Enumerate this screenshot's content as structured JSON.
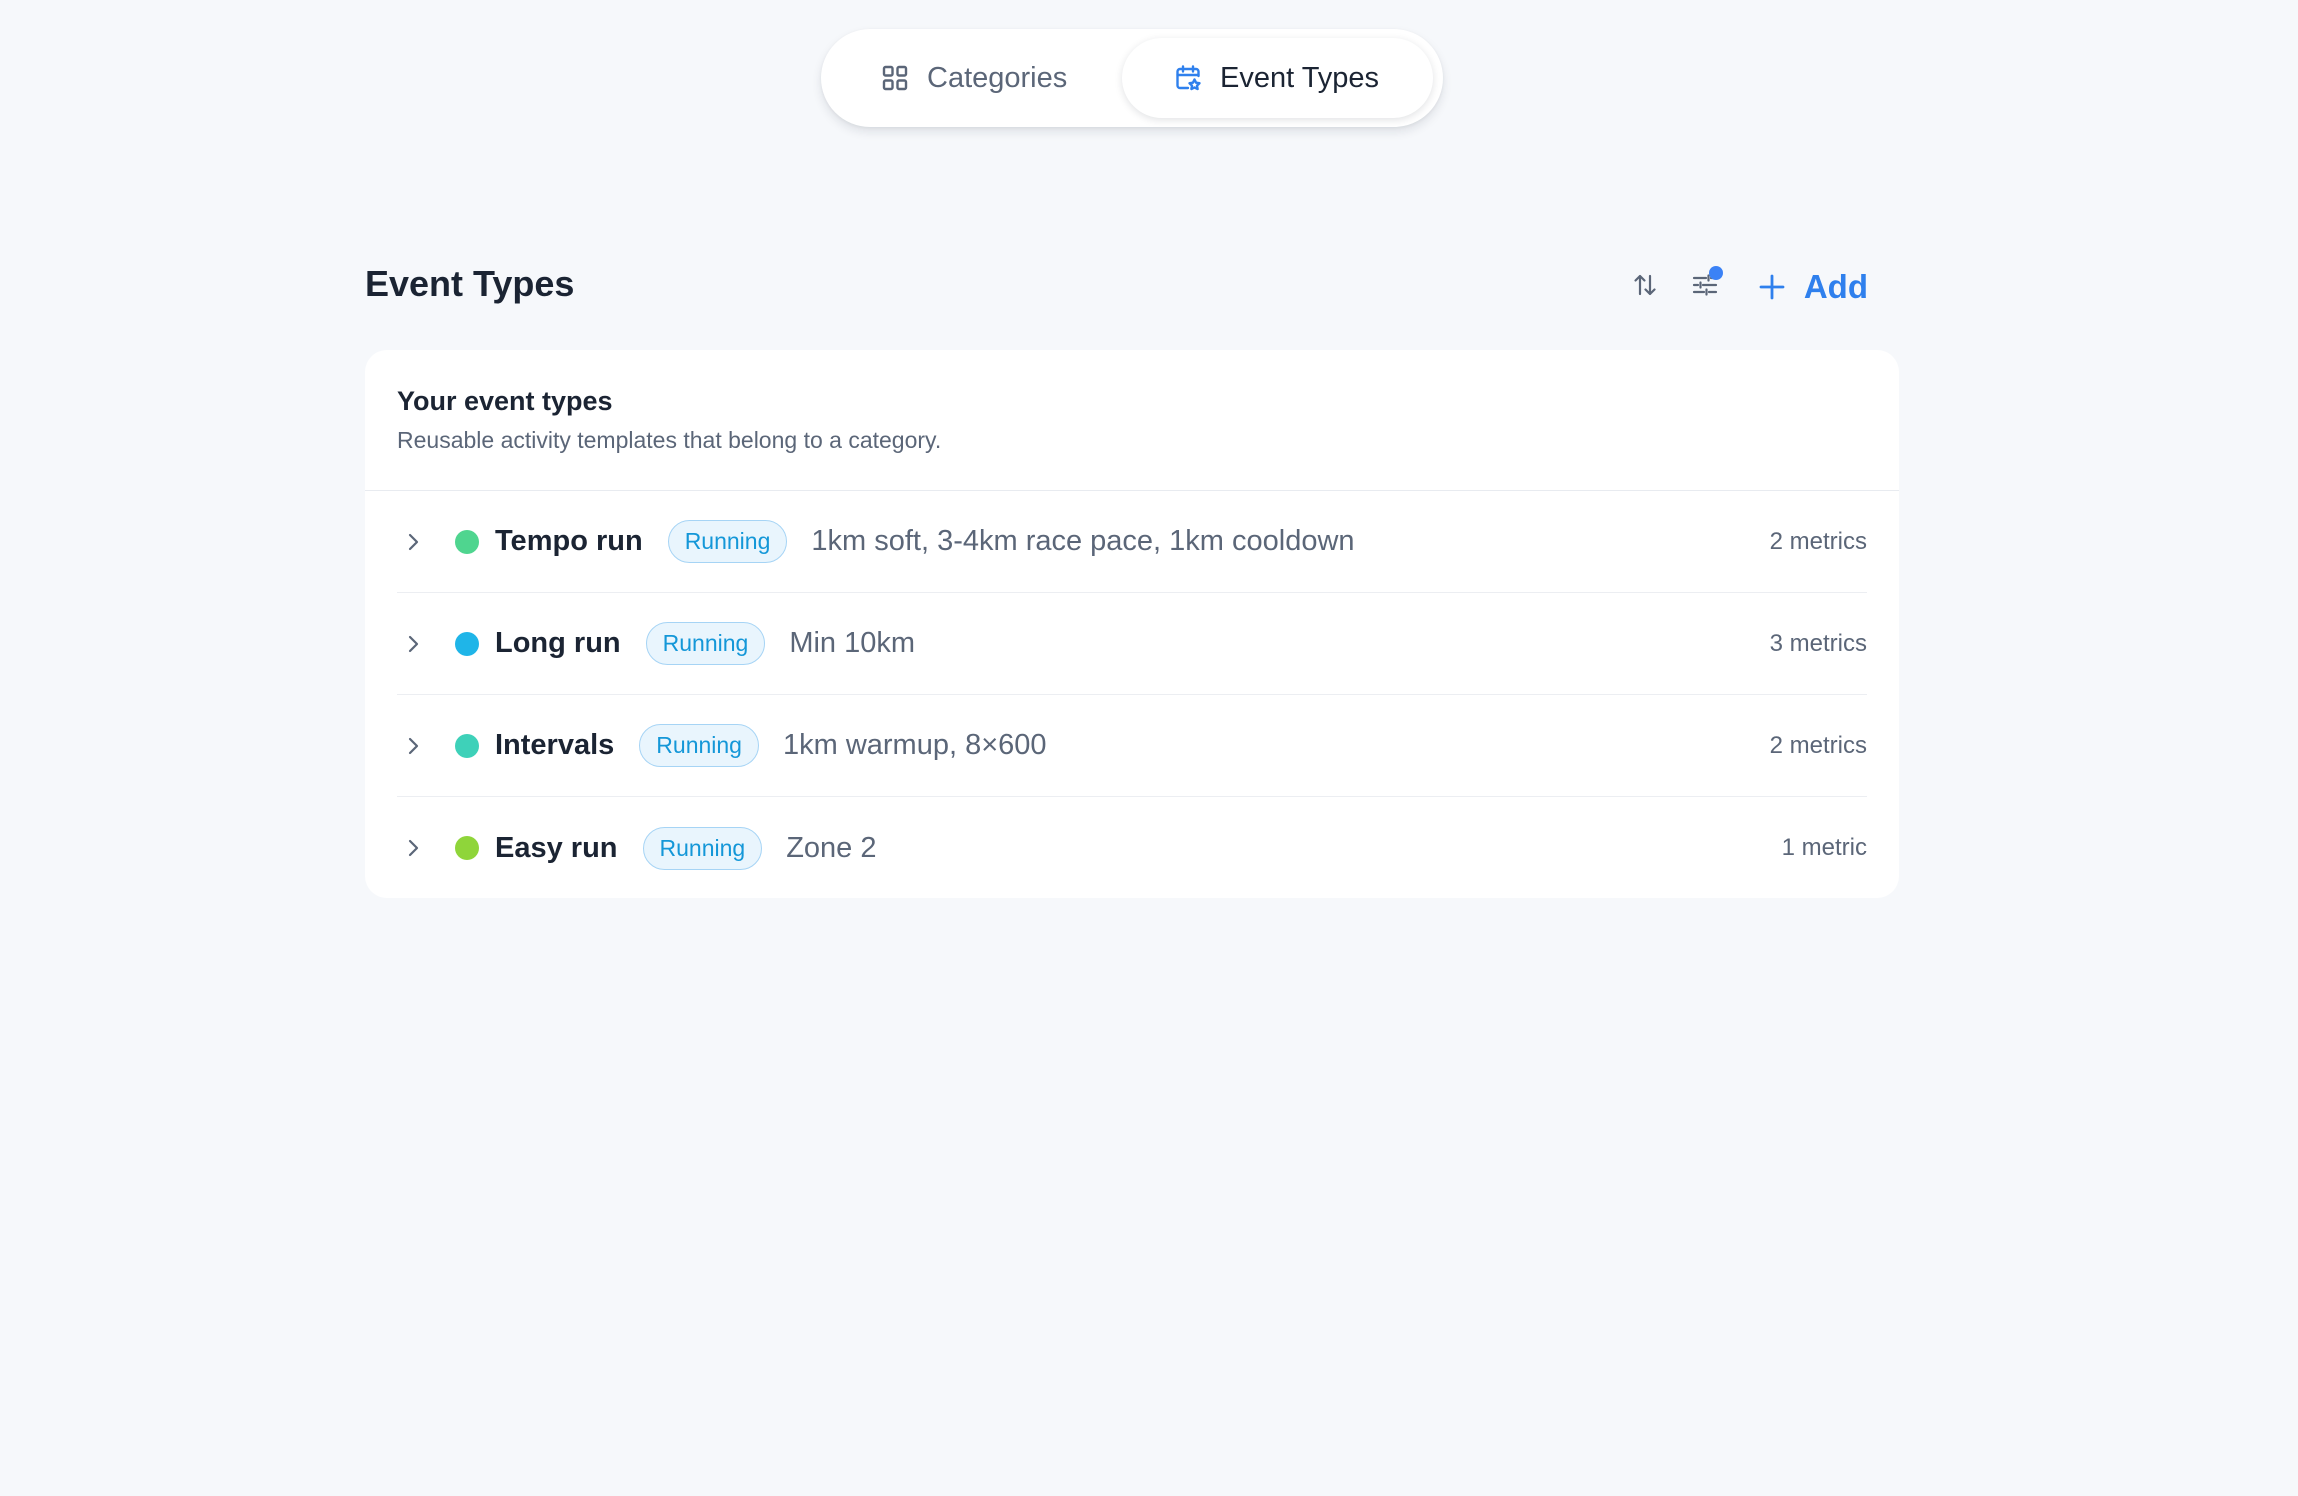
{
  "segmented": {
    "tabs": [
      {
        "label": "Categories",
        "icon": "grid-icon",
        "active": false
      },
      {
        "label": "Event Types",
        "icon": "calendar-star-icon",
        "active": true
      }
    ]
  },
  "header": {
    "title": "Event Types",
    "sort_icon": "sort-arrows-icon",
    "filter_icon": "sliders-icon",
    "add_label": "Add"
  },
  "card": {
    "title": "Your event types",
    "subtitle": "Reusable activity templates that belong to a category."
  },
  "event_types": [
    {
      "name": "Tempo run",
      "color": "#4fd58f",
      "category": "Running",
      "description": "1km soft, 3-4km race pace, 1km cooldown",
      "metrics": "2 metrics"
    },
    {
      "name": "Long run",
      "color": "#1fb5e8",
      "category": "Running",
      "description": "Min 10km",
      "metrics": "3 metrics"
    },
    {
      "name": "Intervals",
      "color": "#3ed1b9",
      "category": "Running",
      "description": "1km warmup, 8×600",
      "metrics": "2 metrics"
    },
    {
      "name": "Easy run",
      "color": "#8fd53a",
      "category": "Running",
      "description": "Zone 2",
      "metrics": "1 metric"
    }
  ],
  "colors": {
    "accent": "#2f80ed",
    "badge_text": "#1497d8",
    "badge_bg": "#e9f5fd",
    "filter_indicator": "#3b82f6",
    "background": "#f6f8fb"
  }
}
